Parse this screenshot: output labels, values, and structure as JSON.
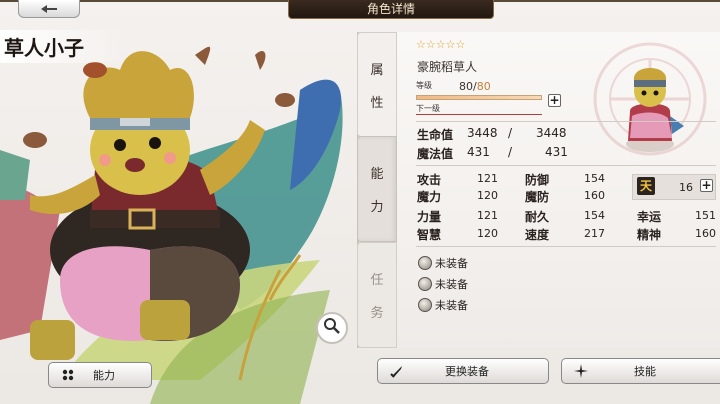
{
  "header": {
    "title": "角色详情",
    "back_icon": "arrow-left-icon"
  },
  "character": {
    "name": "草人小子",
    "stars": "☆☆☆☆☆",
    "class_name": "豪腕稻草人",
    "level_label": "等级",
    "level": "80",
    "level_sep": "/",
    "level_max": "80",
    "next_label": "下一级"
  },
  "tabs": {
    "attr": [
      "属",
      "性"
    ],
    "ability": [
      "能",
      "力"
    ],
    "task": [
      "任",
      "务"
    ]
  },
  "vitals": {
    "hp_label": "生命值",
    "hp": "3448",
    "hp_max": "3448",
    "mp_label": "魔法值",
    "mp": "431",
    "mp_max": "431",
    "sep": "/"
  },
  "stats": {
    "atk_label": "攻击",
    "atk": "121",
    "def_label": "防御",
    "def": "154",
    "mag_label": "魔力",
    "mag": "120",
    "mdef_label": "魔防",
    "mdef": "160",
    "str_label": "力量",
    "str": "121",
    "end_label": "耐久",
    "end": "154",
    "luck_label": "幸运",
    "luck": "151",
    "wis_label": "智慧",
    "wis": "120",
    "spd_label": "速度",
    "spd": "217",
    "spi_label": "精神",
    "spi": "160",
    "ten_icon": "天",
    "ten_value": "16"
  },
  "equipment": [
    {
      "label": "未装备",
      "icon": "equip-slot-icon"
    },
    {
      "label": "未装备",
      "icon": "equip-slot-icon"
    },
    {
      "label": "未装备",
      "icon": "equip-slot-icon"
    }
  ],
  "buttons": {
    "ability": "能力",
    "change_equip": "更换装备",
    "skills": "技能"
  },
  "colors": {
    "accent": "#c2833a",
    "header_bg": "#2a1d14",
    "star": "#d9a531"
  }
}
